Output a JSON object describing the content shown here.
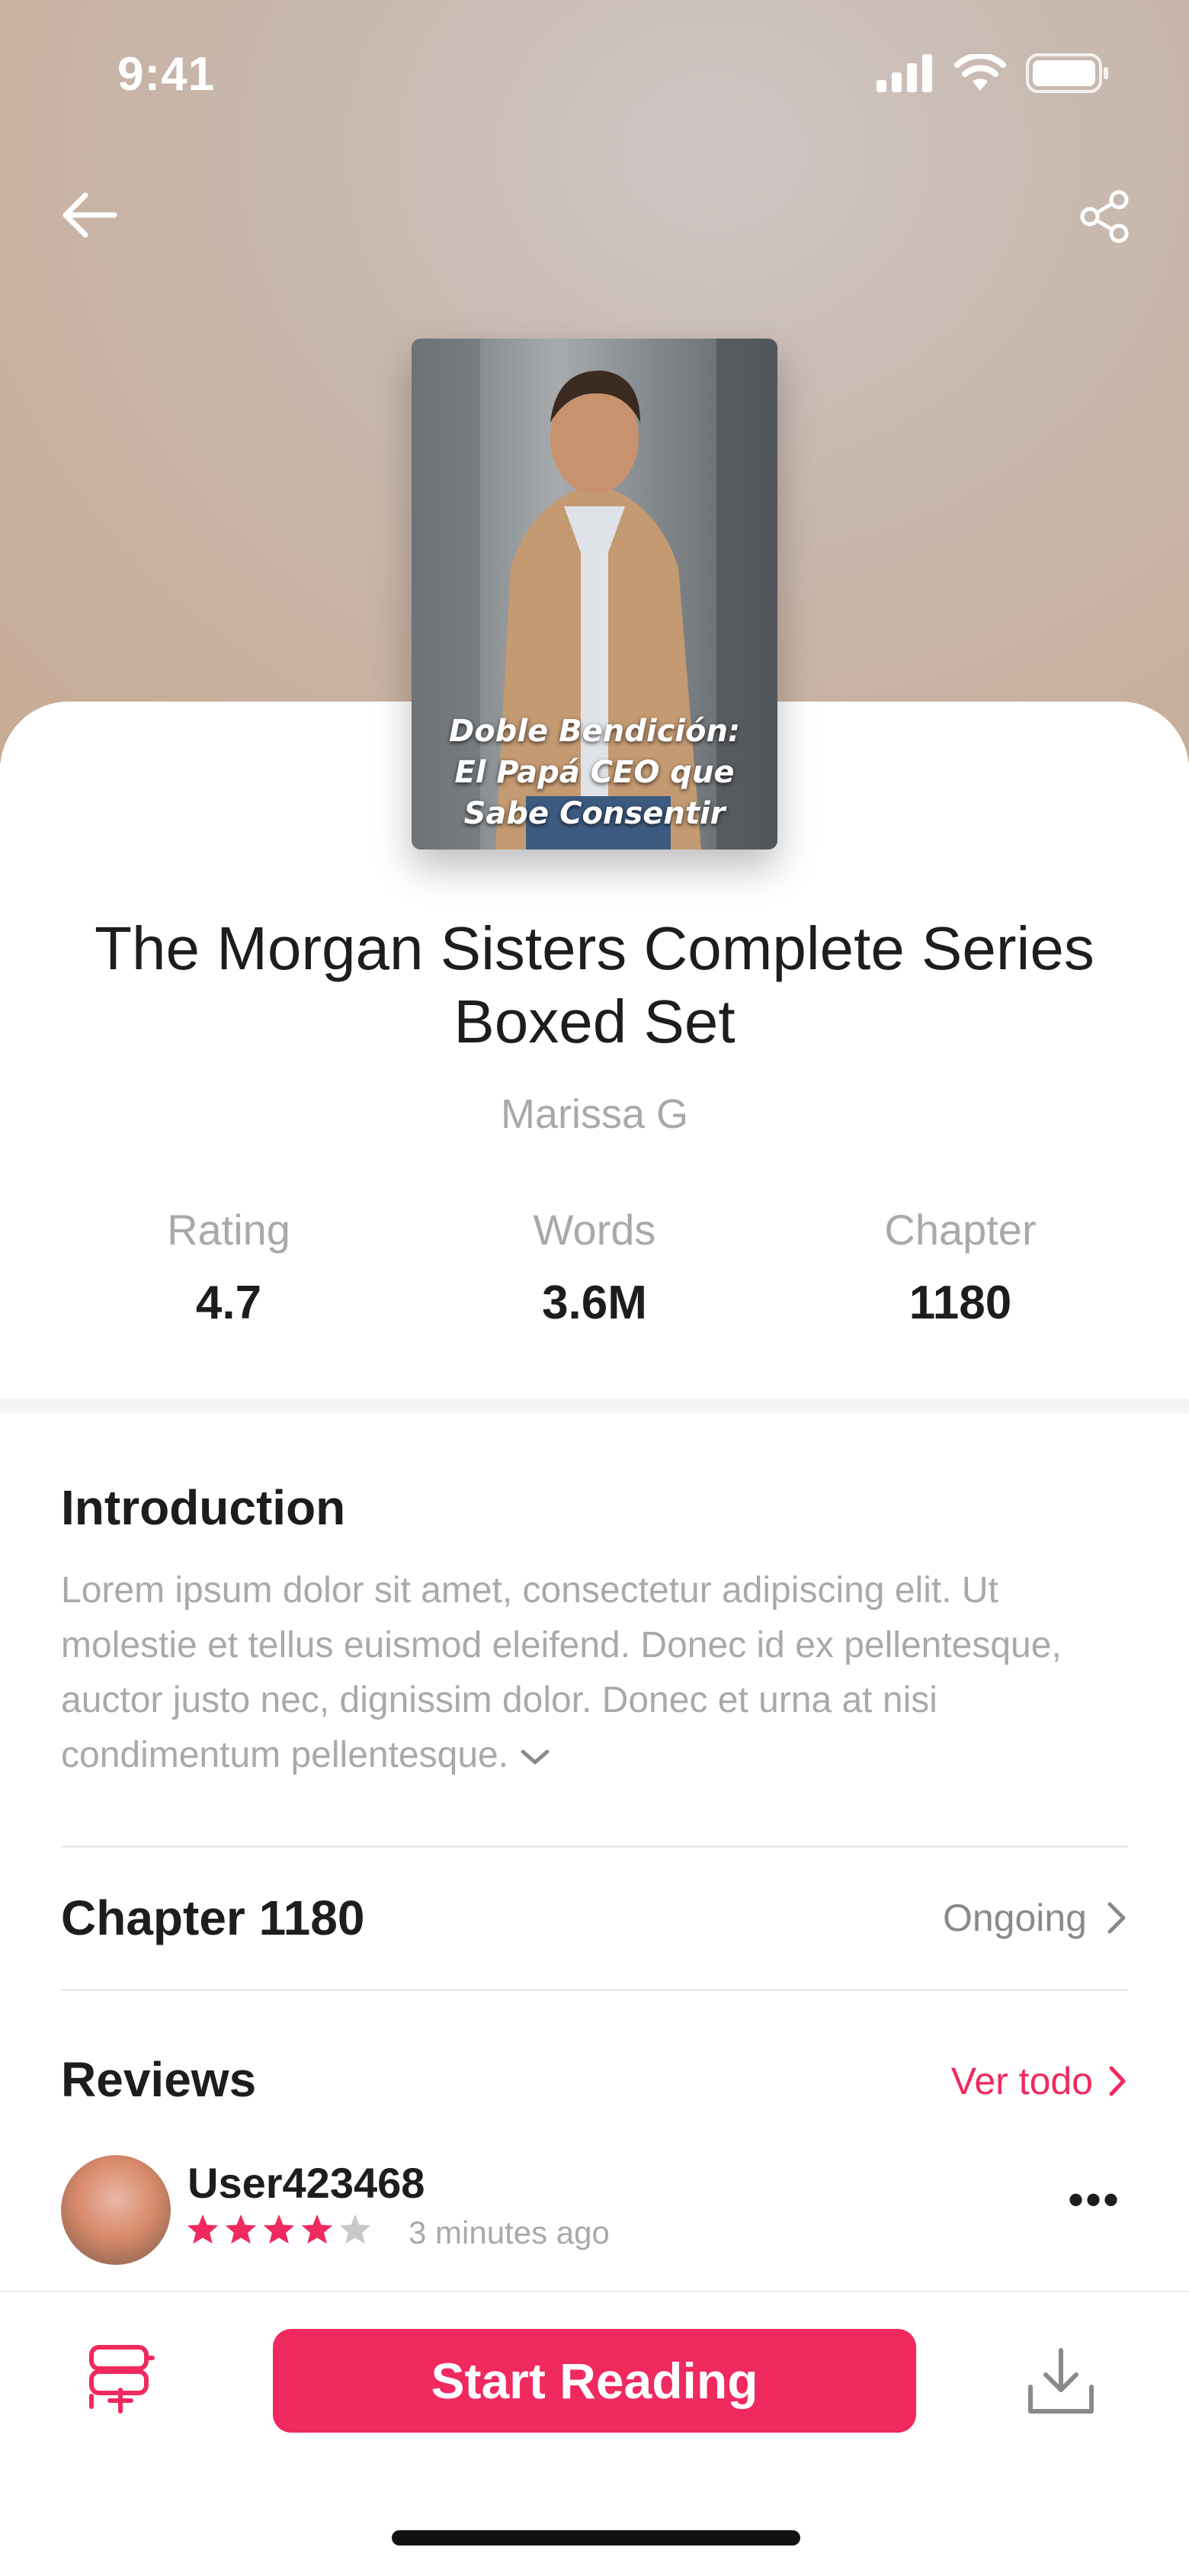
{
  "status_bar": {
    "time": "9:41"
  },
  "book": {
    "cover_lines": [
      "Doble Bendición:",
      "El Papá CEO que",
      "Sabe Consentir"
    ],
    "title": "The Morgan Sisters Complete Series Boxed Set",
    "author": "Marissa G"
  },
  "stats": [
    {
      "label": "Rating",
      "value": "4.7"
    },
    {
      "label": "Words",
      "value": "3.6M"
    },
    {
      "label": "Chapter",
      "value": "1180"
    }
  ],
  "introduction": {
    "heading": "Introduction",
    "text": "Lorem ipsum dolor sit amet, consectetur adipiscing elit. Ut molestie et tellus euismod eleifend. Donec id ex pellentesque, auctor justo nec, dignissim dolor. Donec et urna at nisi condimentum pellentesque."
  },
  "chapter": {
    "title": "Chapter 1180",
    "status": "Ongoing"
  },
  "reviews": {
    "heading": "Reviews",
    "see_all": "Ver todo",
    "items": [
      {
        "user": "User423468",
        "rating": 4,
        "time_ago": "3 minutes ago"
      }
    ]
  },
  "actions": {
    "start_reading": "Start Reading"
  },
  "colors": {
    "accent": "#f0295f",
    "text": "#1d1d1d",
    "muted": "#a9a9a9"
  }
}
